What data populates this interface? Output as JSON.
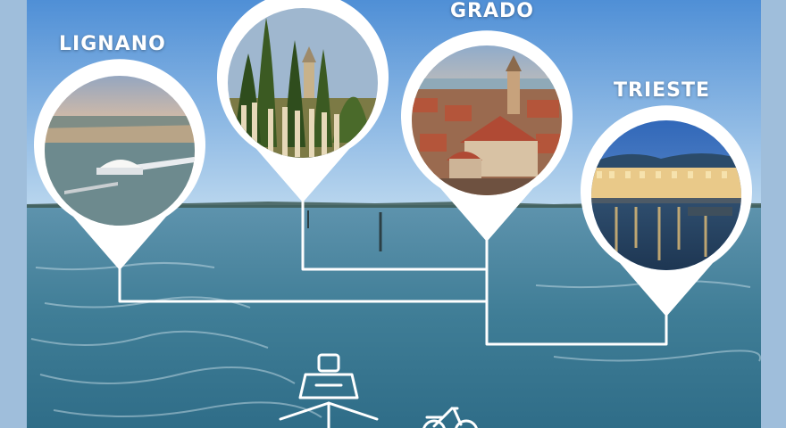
{
  "destinations": [
    {
      "id": "lignano",
      "label": "LIGNANO",
      "photo": "pier-at-sunset"
    },
    {
      "id": "aquileia",
      "label": "",
      "photo": "cypress-and-roman-columns"
    },
    {
      "id": "grado",
      "label": "GRADO",
      "photo": "old-town-rooftops"
    },
    {
      "id": "trieste",
      "label": "TRIESTE",
      "photo": "waterfront-at-night"
    }
  ],
  "icons": {
    "transport_primary": "ferry-icon",
    "transport_secondary": "bicycle-icon"
  },
  "colors": {
    "pin": "#ffffff",
    "route": "#ffffff",
    "sky": "#7fb0e0",
    "sea": "#3f7d96"
  }
}
